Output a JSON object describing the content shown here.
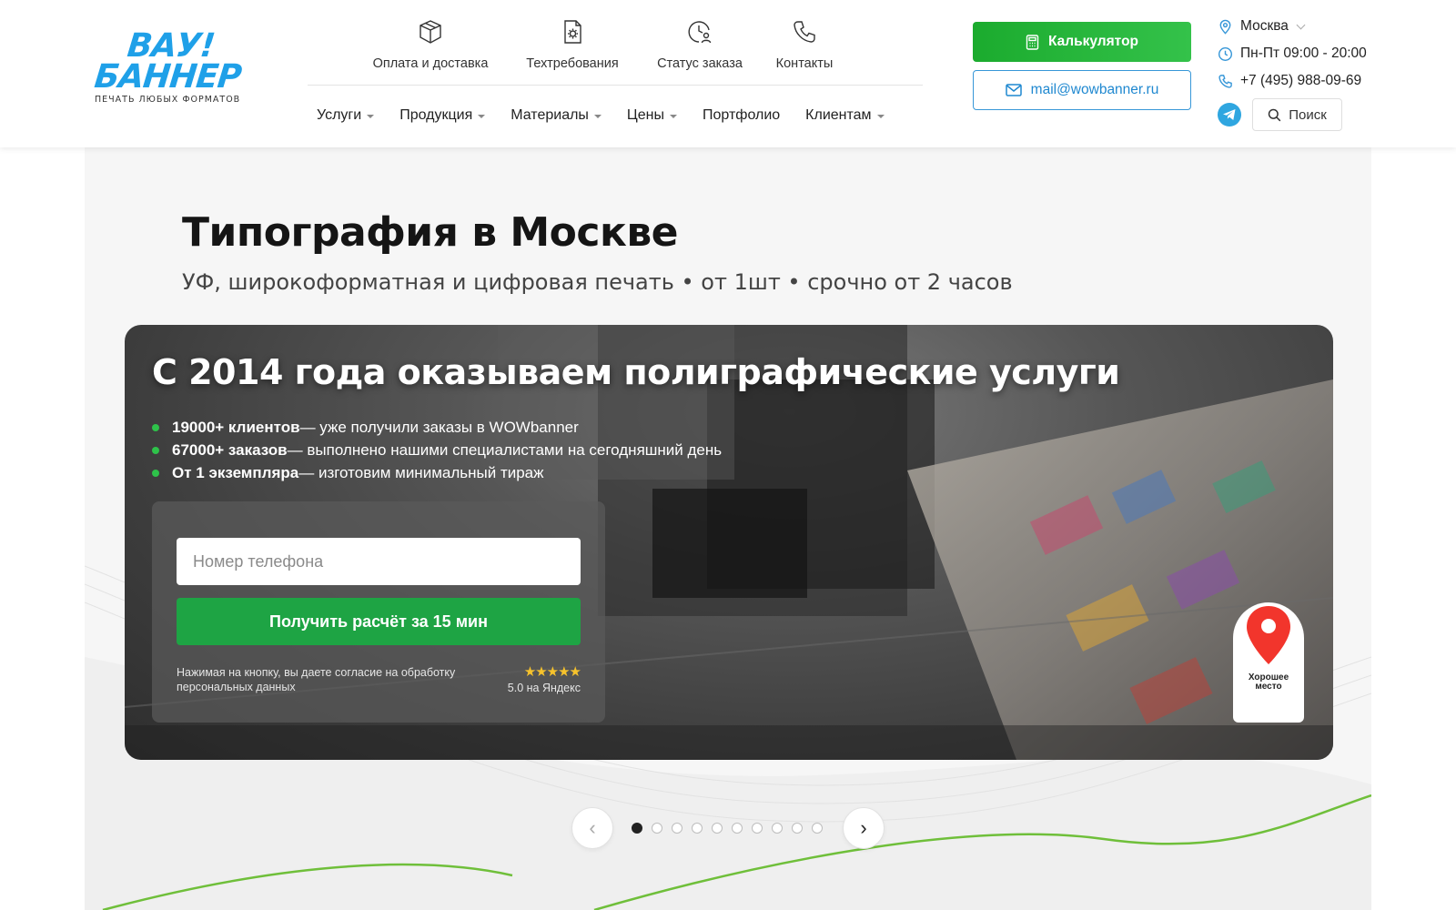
{
  "logo": {
    "line1": "ВАУ!",
    "line2": "БАННЕР",
    "tagline": "ПЕЧАТЬ ЛЮБЫХ ФОРМАТОВ"
  },
  "topnav": [
    {
      "label": "Оплата и доставка",
      "icon": "box-icon"
    },
    {
      "label": "Техтребования",
      "icon": "document-gear-icon"
    },
    {
      "label": "Статус заказа",
      "icon": "clock-user-icon"
    },
    {
      "label": "Контакты",
      "icon": "phone-icon"
    }
  ],
  "mainnav": [
    {
      "label": "Услуги",
      "dropdown": true
    },
    {
      "label": "Продукция",
      "dropdown": true
    },
    {
      "label": "Материалы",
      "dropdown": true
    },
    {
      "label": "Цены",
      "dropdown": true
    },
    {
      "label": "Портфолио",
      "dropdown": false
    },
    {
      "label": "Клиентам",
      "dropdown": true
    }
  ],
  "buttons": {
    "calculator": "Калькулятор",
    "email": "mail@wowbanner.ru"
  },
  "contacts": {
    "city": "Москва",
    "hours": "Пн-Пт 09:00 - 20:00",
    "phone": "+7 (495) 988-09-69"
  },
  "search": {
    "label": "Поиск"
  },
  "page": {
    "title": "Типография в Москве",
    "subtitle": "УФ, широкоформатная и цифровая печать • от 1шт • срочно от 2 часов"
  },
  "hero": {
    "title": "С 2014 года оказываем полиграфические услуги",
    "bullets": [
      {
        "bold": "19000+ клиентов",
        "text": " — уже получили заказы в WOWbanner"
      },
      {
        "bold": "67000+ заказов",
        "text": " — выполнено нашими специалистами на сегодняшний день"
      },
      {
        "bold": "От 1 экземпляра",
        "text": " — изготовим минимальный тираж"
      }
    ],
    "form": {
      "phone_placeholder": "Номер телефона",
      "phone_value": "",
      "submit": "Получить расчёт за 15 мин",
      "consent": "Нажимая на кнопку, вы даете согласие на обработку персональных данных",
      "stars": "★★★★★",
      "rating": "5.0 на Яндекс"
    },
    "badge": "Хорошее место"
  },
  "slider": {
    "total": 10,
    "active": 1,
    "prev": "‹",
    "next": "›"
  },
  "colors": {
    "accent_green": "#1ea444",
    "accent_blue": "#1fa0e8",
    "bullet_dot": "#2ec24a",
    "star": "#f6c22c",
    "map_pin": "#f2352c"
  }
}
